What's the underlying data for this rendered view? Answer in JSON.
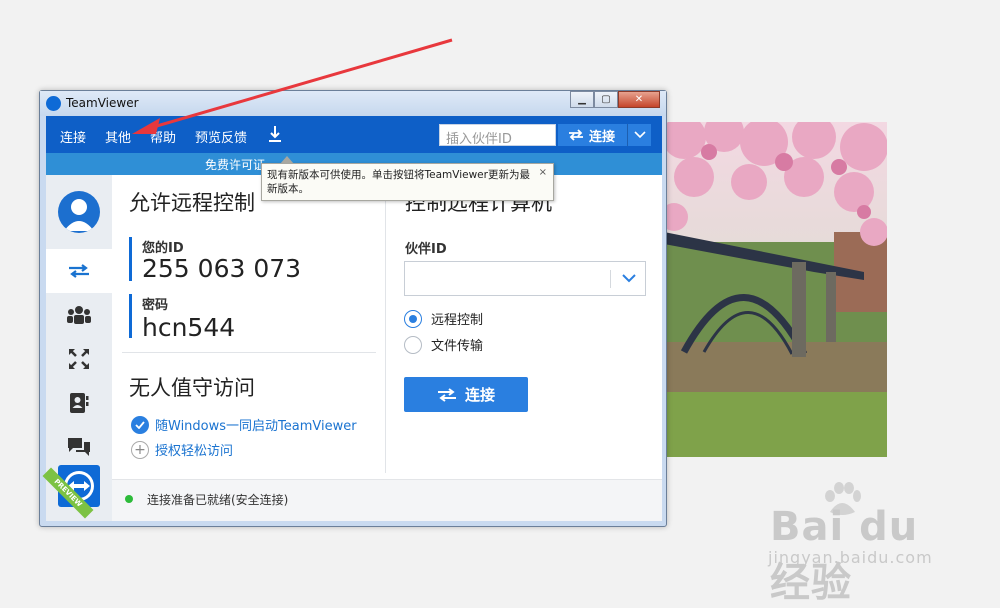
{
  "window": {
    "title": "TeamViewer"
  },
  "menu": {
    "items": [
      "连接",
      "其他",
      "帮助",
      "预览反馈"
    ]
  },
  "header": {
    "partner_placeholder": "插入伙伴ID",
    "connect_label": "连接"
  },
  "license_bar": {
    "text": "免费许可证..."
  },
  "tooltip": {
    "text": "现有新版本可供使用。单击按钮将TeamViewer更新为最新版本。",
    "close": "×"
  },
  "left_panel": {
    "title": "允许远程控制",
    "id_label": "您的ID",
    "id_value": "255 063 073",
    "password_label": "密码",
    "password_value": "hcn544",
    "unattended_title": "无人值守访问",
    "start_with_windows": "随Windows一同启动TeamViewer",
    "grant_easy_access": "授权轻松访问"
  },
  "right_panel": {
    "title": "控制远程计算机",
    "partner_id_label": "伙伴ID",
    "partner_id_value": "",
    "option_remote": "远程控制",
    "option_file": "文件传输",
    "selected_option": "远程控制",
    "connect_label": "连接"
  },
  "status": {
    "text": "连接准备已就绪(安全连接)"
  },
  "sidebar": {
    "icons": [
      "avatar-icon",
      "remote-control-icon",
      "meeting-icon",
      "fullscreen-icon",
      "contacts-icon",
      "chat-icon",
      "teamviewer-logo-icon"
    ],
    "ribbon": "PREVIEW"
  },
  "watermark": {
    "brand": "Bai du 经验",
    "site": "jingyan.baidu.com"
  },
  "colors": {
    "accent": "#0e5fc7",
    "button": "#2a7fe0",
    "status_ok": "#2dbb3a",
    "annotation_arrow": "#e8383d"
  }
}
